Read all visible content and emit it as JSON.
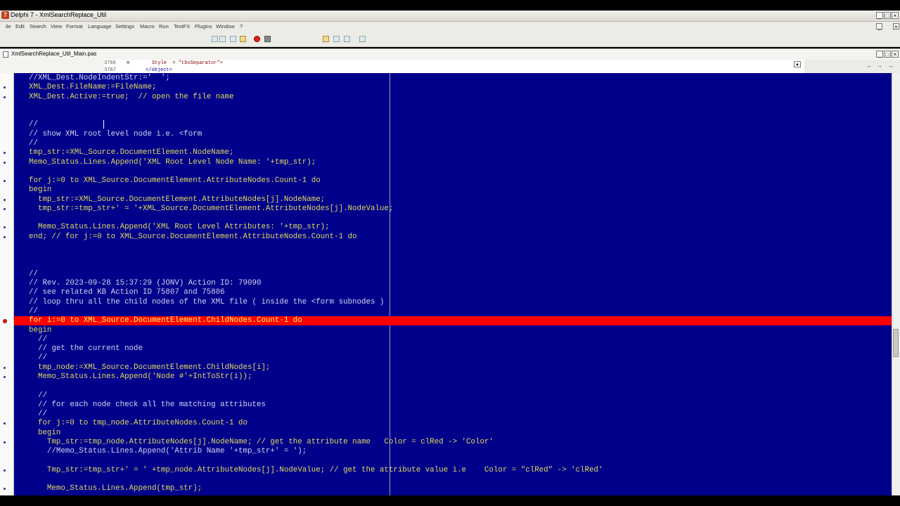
{
  "window": {
    "title": "Delphi 7 - XmlSearchReplace_Util",
    "app_icon": "delphi-icon"
  },
  "menu": [
    "ile",
    "Edit",
    "Search",
    "View",
    "Format",
    "Language",
    "Settings",
    "Macro",
    "Run",
    "TextFX",
    "Plugins",
    "Window",
    "?"
  ],
  "tab": {
    "filename": "XmlSearchReplace_Util_Main.pas"
  },
  "preview": {
    "line1_num": "3766",
    "line1_text": "Style  = \"tbsSeparator\">",
    "line2_num": "3767",
    "line2_text": "</object>"
  },
  "code": [
    {
      "text": "//XML_Dest.NodeIndentStr:='  ';",
      "kind": "comment",
      "mark": false
    },
    {
      "text": "XML_Dest.FileName:=FileName;",
      "kind": "code",
      "mark": true
    },
    {
      "text": "XML_Dest.Active:=true;  // open the file name",
      "kind": "code",
      "mark": true
    },
    {
      "text": "",
      "kind": "code",
      "mark": false
    },
    {
      "text": "",
      "kind": "code",
      "mark": false
    },
    {
      "text": "//",
      "kind": "comment",
      "mark": false
    },
    {
      "text": "// show XML root level node i.e. <form",
      "kind": "comment",
      "mark": false
    },
    {
      "text": "//",
      "kind": "comment",
      "mark": false
    },
    {
      "text": "tmp_str:=XML_Source.DocumentElement.NodeName;",
      "kind": "code",
      "mark": true
    },
    {
      "text": "Memo_Status.Lines.Append('XML Root Level Node Name: '+tmp_str);",
      "kind": "code",
      "mark": true
    },
    {
      "text": "",
      "kind": "code",
      "mark": false
    },
    {
      "text": "for j:=0 to XML_Source.DocumentElement.AttributeNodes.Count-1 do",
      "kind": "code",
      "mark": true
    },
    {
      "text": "begin",
      "kind": "code",
      "mark": false
    },
    {
      "text": "  tmp_str:=XML_Source.DocumentElement.AttributeNodes[j].NodeName;",
      "kind": "code",
      "mark": true
    },
    {
      "text": "  tmp_str:=tmp_str+' = '+XML_Source.DocumentElement.AttributeNodes[j].NodeValue;",
      "kind": "code",
      "mark": true
    },
    {
      "text": "",
      "kind": "code",
      "mark": false
    },
    {
      "text": "  Memo_Status.Lines.Append('XML Root Level Attributes: '+tmp_str);",
      "kind": "code",
      "mark": true
    },
    {
      "text": "end; // for j:=0 to XML_Source.DocumentElement.AttributeNodes.Count-1 do",
      "kind": "code",
      "mark": true
    },
    {
      "text": "",
      "kind": "code",
      "mark": false
    },
    {
      "text": "",
      "kind": "code",
      "mark": false
    },
    {
      "text": "",
      "kind": "code",
      "mark": false
    },
    {
      "text": "//",
      "kind": "comment",
      "mark": false
    },
    {
      "text": "// Rev. 2023-09-28 15:37:29 (JONV) Action ID: 79090",
      "kind": "comment",
      "mark": false
    },
    {
      "text": "// see related KB Action ID 75807 and 75806",
      "kind": "comment",
      "mark": false
    },
    {
      "text": "// loop thru all the child nodes of the XML file ( inside the <form subnodes )",
      "kind": "comment",
      "mark": false
    },
    {
      "text": "//",
      "kind": "comment",
      "mark": false
    },
    {
      "text": "for i:=0 to XML_Source.DocumentElement.ChildNodes.Count-1 do",
      "kind": "breakpoint",
      "mark": true
    },
    {
      "text": "begin",
      "kind": "code",
      "mark": false
    },
    {
      "text": "  //",
      "kind": "comment",
      "mark": false
    },
    {
      "text": "  // get the current node",
      "kind": "comment",
      "mark": false
    },
    {
      "text": "  //",
      "kind": "comment",
      "mark": false
    },
    {
      "text": "  tmp_node:=XML_Source.DocumentElement.ChildNodes[i];",
      "kind": "code",
      "mark": true
    },
    {
      "text": "  Memo_Status.Lines.Append('Node #'+IntToStr(i));",
      "kind": "code",
      "mark": true
    },
    {
      "text": "",
      "kind": "code",
      "mark": false
    },
    {
      "text": "  //",
      "kind": "comment",
      "mark": false
    },
    {
      "text": "  // for each node check all the matching attributes",
      "kind": "comment",
      "mark": false
    },
    {
      "text": "  //",
      "kind": "comment",
      "mark": false
    },
    {
      "text": "  for j:=0 to tmp_node.AttributeNodes.Count-1 do",
      "kind": "code",
      "mark": true
    },
    {
      "text": "  begin",
      "kind": "code",
      "mark": false
    },
    {
      "text": "    Tmp_str:=tmp_node.AttributeNodes[j].NodeName; // get the attribute name   Color = clRed -> 'Color'",
      "kind": "code",
      "mark": true
    },
    {
      "text": "    //Memo_Status.Lines.Append('Attrib Name '+tmp_str+' = ');",
      "kind": "comment",
      "mark": false
    },
    {
      "text": "",
      "kind": "code",
      "mark": false
    },
    {
      "text": "    Tmp_str:=tmp_str+' = ' +tmp_node.AttributeNodes[j].NodeValue; // get the attribute value i.e    Color = \"clRed\" -> 'clRed'",
      "kind": "code",
      "mark": true
    },
    {
      "text": "",
      "kind": "code",
      "mark": false
    },
    {
      "text": "    Memo_Status.Lines.Append(tmp_str);",
      "kind": "code",
      "mark": true
    }
  ],
  "colors": {
    "editor_bg": "#00008b",
    "code_fg": "#e0dc5e",
    "comment_fg": "#d4d4ee",
    "breakpoint_bg": "#ff0000"
  }
}
